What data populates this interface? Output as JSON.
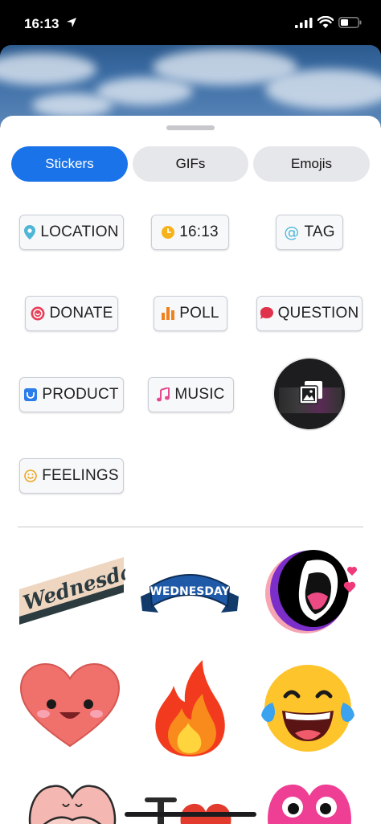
{
  "status_bar": {
    "time": "16:13"
  },
  "tabs": [
    {
      "label": "Stickers",
      "active": true
    },
    {
      "label": "GIFs",
      "active": false
    },
    {
      "label": "Emojis",
      "active": false
    }
  ],
  "stickers": {
    "location": {
      "label": "LOCATION",
      "icon": "location-pin-icon"
    },
    "time": {
      "label": "16:13",
      "icon": "clock-icon"
    },
    "tag": {
      "label": "TAG",
      "icon": "at-sign-icon"
    },
    "donate": {
      "label": "DONATE",
      "icon": "donate-icon"
    },
    "poll": {
      "label": "POLL",
      "icon": "bar-chart-icon"
    },
    "question": {
      "label": "QUESTION",
      "icon": "speech-bubble-icon"
    },
    "product": {
      "label": "PRODUCT",
      "icon": "shopping-bag-icon"
    },
    "music": {
      "label": "MUSIC",
      "icon": "music-note-icon"
    },
    "feelings": {
      "label": "FEELINGS",
      "icon": "smiley-icon"
    },
    "gallery": {
      "icon": "photo-gallery-icon"
    }
  },
  "gifs": [
    {
      "name": "wednesday-retro",
      "text": "Wednesday"
    },
    {
      "name": "wednesday-banner",
      "text": "WEDNESDAY"
    },
    {
      "name": "screaming-mouth"
    },
    {
      "name": "smiling-heart"
    },
    {
      "name": "fire"
    },
    {
      "name": "tears-of-joy"
    },
    {
      "name": "hugging-heart"
    },
    {
      "name": "barbell-heart"
    },
    {
      "name": "pink-heart-eyes"
    }
  ],
  "colors": {
    "accent": "#1a73e8",
    "tab_inactive": "#e6e7ea",
    "sticker_border": "#c9ced6"
  }
}
